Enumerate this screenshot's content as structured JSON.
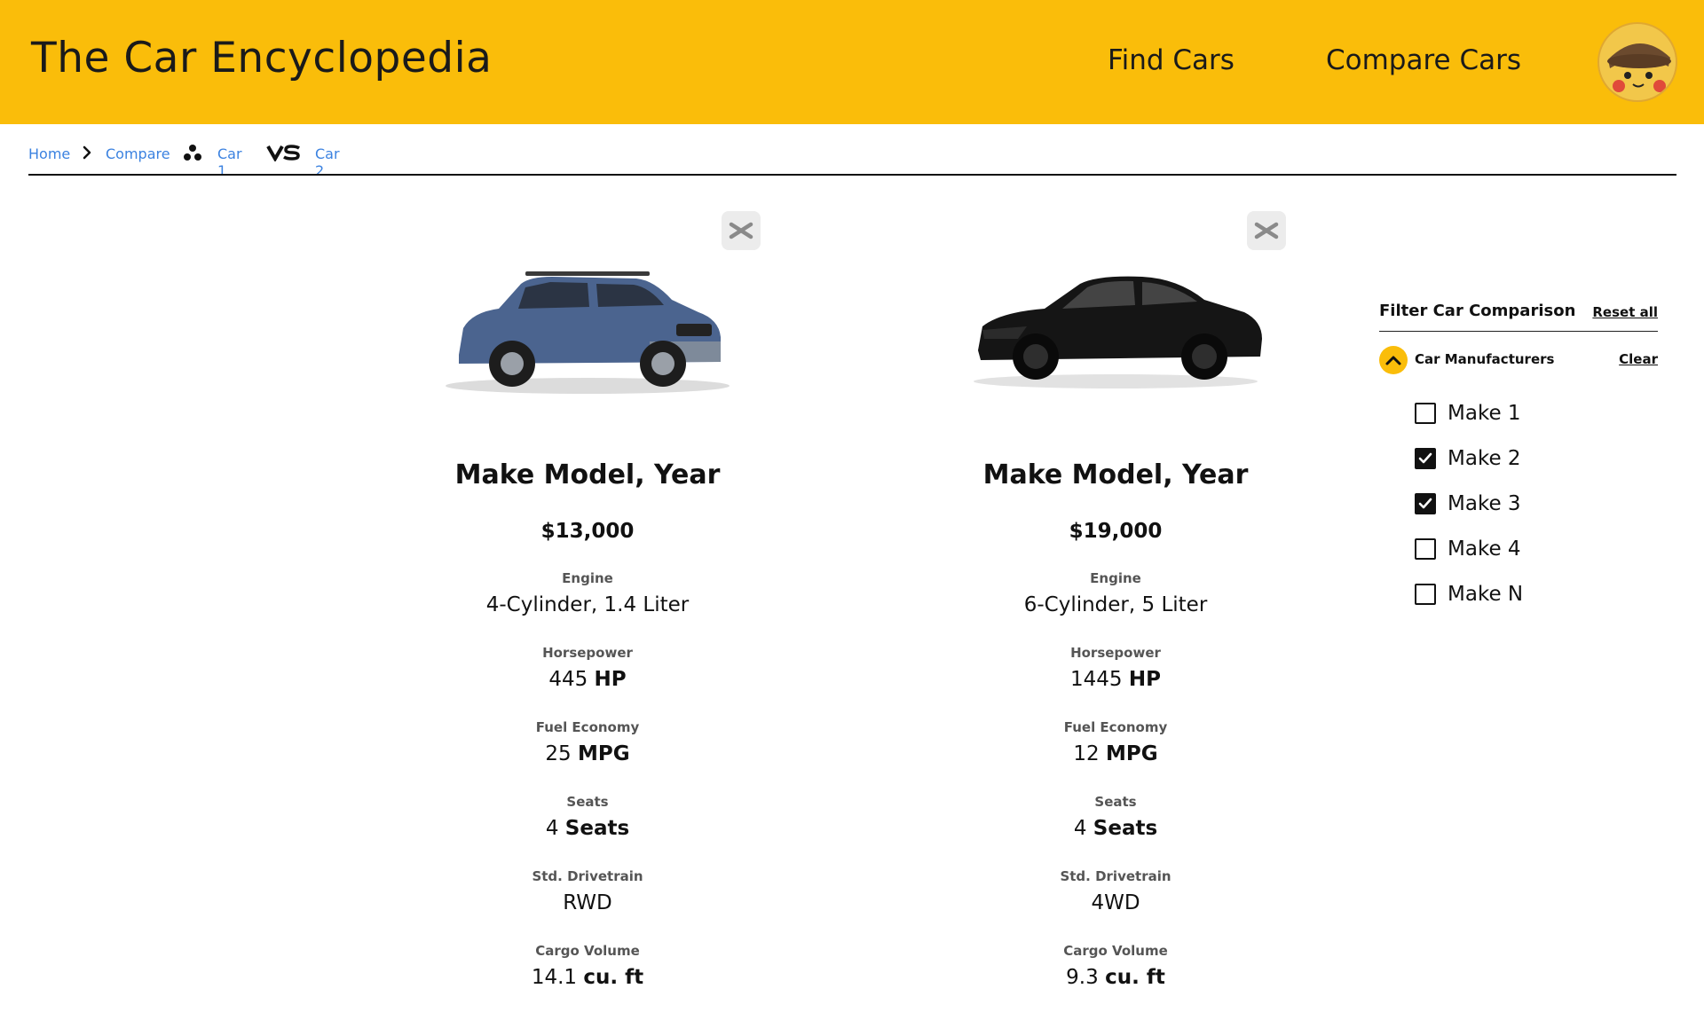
{
  "header": {
    "title": "The Car Encyclopedia",
    "nav": {
      "find": "Find Cars",
      "compare": "Compare Cars"
    },
    "accent_color": "#FABD0A"
  },
  "breadcrumb": {
    "home": "Home",
    "compare": "Compare",
    "car1": "Car 1",
    "car2": "Car 2"
  },
  "cars": [
    {
      "name": "Make Model, Year",
      "price": "$13,000",
      "color": "#4b648f",
      "specs": {
        "engine": {
          "label": "Engine",
          "value": "4-Cylinder, 1.4 Liter"
        },
        "horsepower": {
          "label": "Horsepower",
          "num": "445",
          "unit": "HP"
        },
        "fuel": {
          "label": "Fuel Economy",
          "num": "25",
          "unit": "MPG"
        },
        "seats": {
          "label": "Seats",
          "num": "4",
          "unit": "Seats"
        },
        "drivetrain": {
          "label": "Std. Drivetrain",
          "value": "RWD"
        },
        "cargo": {
          "label": "Cargo Volume",
          "num": "14.1",
          "unit": "cu. ft"
        }
      }
    },
    {
      "name": "Make Model, Year",
      "price": "$19,000",
      "color": "#151515",
      "specs": {
        "engine": {
          "label": "Engine",
          "value": "6-Cylinder, 5 Liter"
        },
        "horsepower": {
          "label": "Horsepower",
          "num": "1445",
          "unit": "HP"
        },
        "fuel": {
          "label": "Fuel Economy",
          "num": "12",
          "unit": "MPG"
        },
        "seats": {
          "label": "Seats",
          "num": "4",
          "unit": "Seats"
        },
        "drivetrain": {
          "label": "Std. Drivetrain",
          "value": "4WD"
        },
        "cargo": {
          "label": "Cargo Volume",
          "num": "9.3",
          "unit": "cu. ft"
        }
      }
    }
  ],
  "filter": {
    "title": "Filter Car Comparison",
    "reset_all": "Reset all",
    "section_title": "Car Manufacturers",
    "clear": "Clear",
    "makes": [
      {
        "label": "Make 1",
        "checked": false
      },
      {
        "label": "Make 2",
        "checked": true
      },
      {
        "label": "Make 3",
        "checked": true
      },
      {
        "label": "Make 4",
        "checked": false
      },
      {
        "label": "Make N",
        "checked": false
      }
    ]
  }
}
